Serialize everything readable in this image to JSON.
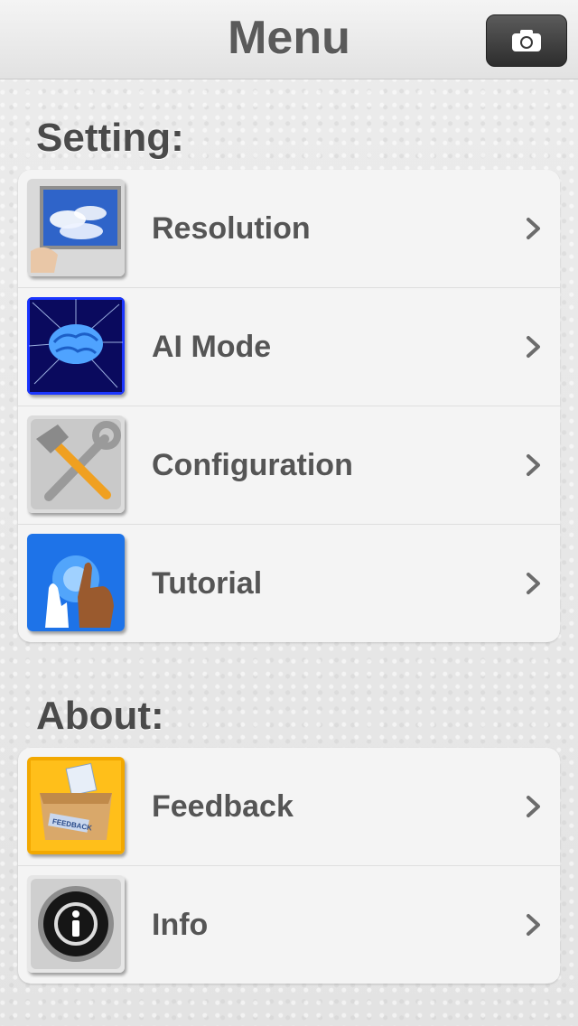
{
  "navbar": {
    "title": "Menu"
  },
  "sections": [
    {
      "title": "Setting:",
      "items": [
        {
          "label": "Resolution"
        },
        {
          "label": "AI Mode"
        },
        {
          "label": "Configuration"
        },
        {
          "label": "Tutorial"
        }
      ]
    },
    {
      "title": "About:",
      "items": [
        {
          "label": "Feedback"
        },
        {
          "label": "Info"
        }
      ]
    }
  ],
  "feedback_box_text": "FEEDBACK",
  "icons": {
    "camera": "camera-icon",
    "chevron": "chevron-right-icon"
  }
}
